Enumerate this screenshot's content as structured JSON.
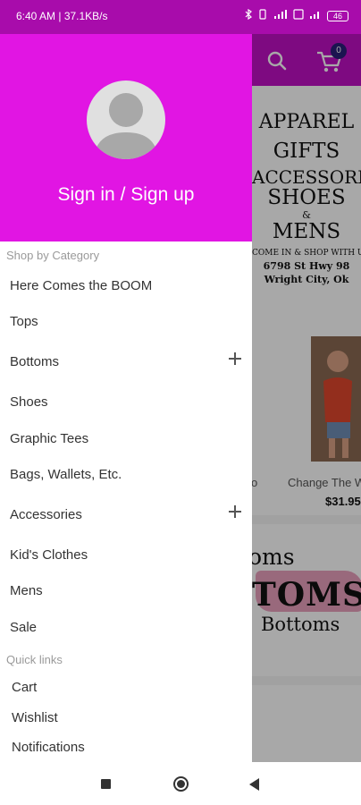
{
  "status_bar": {
    "time_speed": "6:40 AM | 37.1KB/s",
    "battery": "46"
  },
  "toolbar": {
    "cart_count": "0"
  },
  "banner": {
    "lines": [
      "APPAREL",
      "GIFTS",
      "ACCESSORIES",
      "SHOES",
      "&",
      "MENS",
      "COME IN & SHOP WITH US",
      "6798 St Hwy 98",
      "Wright City, Ok"
    ]
  },
  "product": {
    "partial_title": "o",
    "title": "Change The W",
    "price": "$31.95"
  },
  "promo": {
    "line1": "oms",
    "line2": "TOMS",
    "line3": "Bottoms"
  },
  "drawer": {
    "sign_in_label": "Sign in / Sign up",
    "shop_by_category_label": "Shop by Category",
    "categories": [
      {
        "label": "Here Comes the BOOM",
        "expandable": false
      },
      {
        "label": "Tops",
        "expandable": false
      },
      {
        "label": "Bottoms",
        "expandable": true
      },
      {
        "label": "Shoes",
        "expandable": false
      },
      {
        "label": "Graphic Tees",
        "expandable": false
      },
      {
        "label": "Bags, Wallets, Etc.",
        "expandable": false
      },
      {
        "label": "Accessories",
        "expandable": true
      },
      {
        "label": "Kid's Clothes",
        "expandable": false
      },
      {
        "label": "Mens",
        "expandable": false
      },
      {
        "label": "Sale",
        "expandable": false
      }
    ],
    "quick_links_label": "Quick links",
    "quick_links": [
      "Cart",
      "Wishlist",
      "Notifications"
    ]
  },
  "colors": {
    "status_bar": "#a80cab",
    "drawer_header": "#e115e3",
    "toolbar": "#c010c4",
    "cart_badge": "#2a1f7a"
  },
  "icons": {
    "toolbar": [
      "search-icon",
      "cart-icon"
    ],
    "nav_bar": [
      "recents-icon",
      "home-icon",
      "back-icon"
    ],
    "header": [
      "avatar-icon"
    ]
  }
}
